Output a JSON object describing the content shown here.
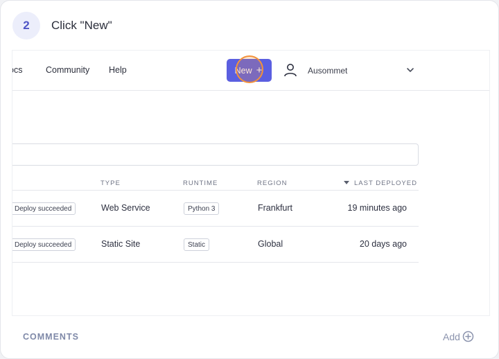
{
  "step": {
    "number": "2",
    "instruction": "Click \"New\""
  },
  "topbar": {
    "nav_links": [
      "Docs",
      "Community",
      "Help"
    ],
    "new_button": {
      "label": "New",
      "icon": "plus-icon"
    },
    "account": {
      "name": "Ausommet",
      "icon": "user-icon",
      "chevron": "chevron-down-icon"
    }
  },
  "table": {
    "columns": [
      "TYPE",
      "RUNTIME",
      "REGION",
      "LAST DEPLOYED"
    ],
    "sorted_column": "LAST DEPLOYED",
    "rows": [
      {
        "status": "Deploy succeeded",
        "type": "Web Service",
        "runtime": "Python 3",
        "region": "Frankfurt",
        "last_deployed": "19 minutes ago"
      },
      {
        "status": "Deploy succeeded",
        "type": "Static Site",
        "runtime": "Static",
        "region": "Global",
        "last_deployed": "20 days ago"
      }
    ]
  },
  "comments": {
    "label": "COMMENTS",
    "add_label": "Add",
    "add_icon": "plus-circle-icon"
  },
  "colors": {
    "accent": "#5b5fe0",
    "click_highlight": "#f3923a",
    "badge_bg": "#eceefb",
    "badge_text": "#4f55c6"
  }
}
